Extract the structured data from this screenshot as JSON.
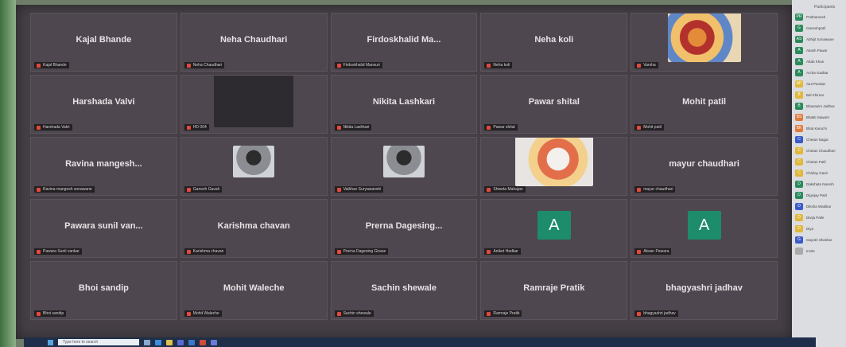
{
  "grid": [
    {
      "name": "Kajal Bhande",
      "label": "Kajal Bhande",
      "kind": "text"
    },
    {
      "name": "Neha Chaudhari",
      "label": "Neha Chaudhari",
      "kind": "text"
    },
    {
      "name": "Firdoskhalid  Ma...",
      "label": "Firdoskhalid Mansuri",
      "kind": "text"
    },
    {
      "name": "Neha koli",
      "label": "Neha koli",
      "kind": "text"
    },
    {
      "name": "",
      "label": "Varsha",
      "kind": "deity"
    },
    {
      "name": "Harshada Valvi",
      "label": "Harshada Valvi",
      "kind": "text"
    },
    {
      "name": "",
      "label": "HD 004",
      "kind": "dark"
    },
    {
      "name": "Nikita Lashkari",
      "label": "Nikita Lashkari",
      "kind": "text"
    },
    {
      "name": "Pawar shital",
      "label": "Pawar shital",
      "kind": "text"
    },
    {
      "name": "Mohit patil",
      "label": "Mohit patil",
      "kind": "text"
    },
    {
      "name": "Ravina  mangesh...",
      "label": "Ravina mangesh sonawane",
      "kind": "text"
    },
    {
      "name": "",
      "label": "Ganesh Gavali",
      "kind": "person"
    },
    {
      "name": "",
      "label": "Vaibhav Suryawanshi",
      "kind": "person"
    },
    {
      "name": "",
      "label": "Shweta Mahajan",
      "kind": "deity2"
    },
    {
      "name": "mayur chaudhari",
      "label": "mayur chaudhari",
      "kind": "text"
    },
    {
      "name": "Pawara sunil van...",
      "label": "Pawara Sunil vankar",
      "kind": "text"
    },
    {
      "name": "Karishma chavan",
      "label": "Karishma chavan",
      "kind": "text"
    },
    {
      "name": "Prerna Dagesing...",
      "label": "Prerna Dagesing Girase",
      "kind": "text"
    },
    {
      "name": "A",
      "label": "Aniket Hadkar",
      "kind": "letter"
    },
    {
      "name": "A",
      "label": "Aksan Pawara",
      "kind": "letter"
    },
    {
      "name": "Bhoi sandip",
      "label": "Bhoi sandip",
      "kind": "text"
    },
    {
      "name": "Mohit Waleche",
      "label": "Mohit Waleche",
      "kind": "text"
    },
    {
      "name": "Sachin shewale",
      "label": "Sachin shewale",
      "kind": "text"
    },
    {
      "name": "Ramraje Pratik",
      "label": "Ramraje Pratik",
      "kind": "text"
    },
    {
      "name": "bhagyashri jadhav",
      "label": "bhagyashri jadhav",
      "kind": "text"
    }
  ],
  "sidebar": {
    "title": "Participants",
    "items": [
      {
        "initials": "PR",
        "name": "Prathamesh",
        "color": "#2a8a5c"
      },
      {
        "initials": "G",
        "name": "Ganeshpatil",
        "color": "#2a8a5c"
      },
      {
        "initials": "AS",
        "name": "Abhijit Sonawane",
        "color": "#2a8a5c"
      },
      {
        "initials": "A",
        "name": "Akash Pawar",
        "color": "#2a8a5c"
      },
      {
        "initials": "A",
        "name": "Aftab Khan",
        "color": "#2a8a5c"
      },
      {
        "initials": "A",
        "name": "Archa Gadkar",
        "color": "#2a8a5c"
      },
      {
        "initials": "AP",
        "name": "Atul Pandav",
        "color": "#e0b83a"
      },
      {
        "initials": "B",
        "name": "Bal Khirnar",
        "color": "#e0b83a"
      },
      {
        "initials": "B",
        "name": "Bhavanim Jadhav",
        "color": "#2a8a5c"
      },
      {
        "initials": "BS",
        "name": "Bhakti Sawant",
        "color": "#e07a3a"
      },
      {
        "initials": "BK",
        "name": "Bhat Karuchi",
        "color": "#e07a3a"
      },
      {
        "initials": "C",
        "name": "Chetan Nagar",
        "color": "#3a5ac8"
      },
      {
        "initials": "C",
        "name": "Chetan Chaudhari",
        "color": "#e0b83a"
      },
      {
        "initials": "C",
        "name": "Chetan Patil",
        "color": "#e0b83a"
      },
      {
        "initials": "C",
        "name": "Chinlay Gavit",
        "color": "#e0b83a"
      },
      {
        "initials": "D",
        "name": "Dakshata Naresh",
        "color": "#2a8a5c"
      },
      {
        "initials": "D",
        "name": "Digvijay Patil",
        "color": "#2a8a5c"
      },
      {
        "initials": "D",
        "name": "Diksha Wadikar",
        "color": "#3a5ac8"
      },
      {
        "initials": "D",
        "name": "Divija Patle",
        "color": "#e0b83a"
      },
      {
        "initials": "D",
        "name": "Diya",
        "color": "#e0b83a"
      },
      {
        "initials": "G",
        "name": "Gayatri Shankar",
        "color": "#3a5ac8"
      },
      {
        "initials": "",
        "name": "Invite",
        "color": "#aaaaaa"
      }
    ]
  },
  "taskbar": {
    "search_placeholder": "Type here to search"
  }
}
